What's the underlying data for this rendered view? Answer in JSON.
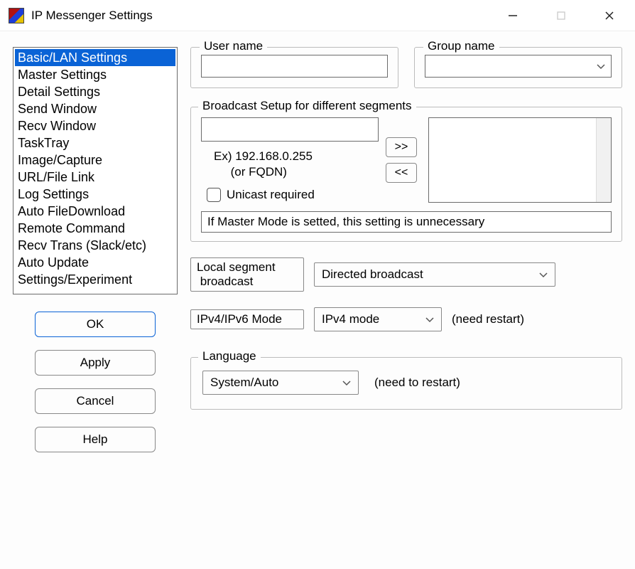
{
  "window": {
    "title": "IP Messenger Settings"
  },
  "sidebar": {
    "items": [
      "Basic/LAN Settings",
      "Master Settings",
      "Detail Settings",
      "Send Window",
      "Recv Window",
      "TaskTray",
      "Image/Capture",
      "URL/File Link",
      "Log Settings",
      "Auto FileDownload",
      "Remote Command",
      "Recv Trans (Slack/etc)",
      "Auto Update",
      "Settings/Experiment"
    ],
    "selected_index": 0
  },
  "buttons": {
    "ok": "OK",
    "apply": "Apply",
    "cancel": "Cancel",
    "help": "Help"
  },
  "user_group": {
    "user_label": "User name",
    "user_value": "",
    "group_label": "Group name",
    "group_value": ""
  },
  "broadcast": {
    "legend": "Broadcast Setup for different segments",
    "ip_value": "",
    "example_line1": "Ex) 192.168.0.255",
    "example_line2": "(or FQDN)",
    "unicast_label": "Unicast required",
    "unicast_checked": false,
    "add_label": ">>",
    "remove_label": "<<",
    "note": "If Master Mode is setted, this setting is unnecessary"
  },
  "local_broadcast": {
    "label_line1": "Local segment",
    "label_line2": "broadcast",
    "selected": "Directed broadcast"
  },
  "ipmode": {
    "label": "IPv4/IPv6 Mode",
    "selected": "IPv4 mode",
    "hint": "(need restart)"
  },
  "language": {
    "legend": "Language",
    "selected": "System/Auto",
    "hint": "(need to restart)"
  }
}
